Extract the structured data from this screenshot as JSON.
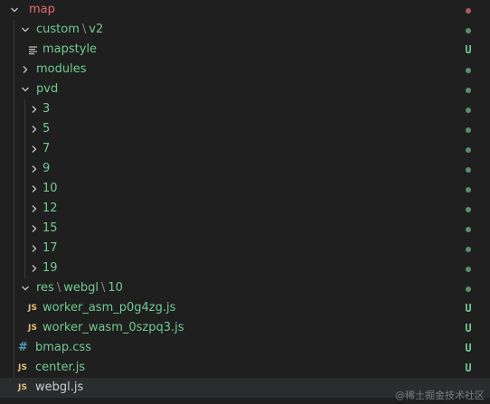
{
  "tree": {
    "rows": [
      {
        "label": "map",
        "path": [],
        "type": "folder",
        "open": true,
        "level": 0,
        "color": "red",
        "status": "dot-red"
      },
      {
        "label": "custom",
        "path": [
          "v2"
        ],
        "type": "folder",
        "open": true,
        "level": 1,
        "color": "green",
        "status": "dot"
      },
      {
        "label": "mapstyle",
        "path": [],
        "type": "file",
        "icon": "lines",
        "level": 2,
        "color": "green",
        "status": "U"
      },
      {
        "label": "modules",
        "path": [],
        "type": "folder",
        "open": false,
        "level": 1,
        "color": "green",
        "status": "dot"
      },
      {
        "label": "pvd",
        "path": [],
        "type": "folder",
        "open": true,
        "level": 1,
        "color": "green",
        "status": "dot"
      },
      {
        "label": "3",
        "path": [],
        "type": "folder",
        "open": false,
        "level": 2,
        "color": "green",
        "status": "dot"
      },
      {
        "label": "5",
        "path": [],
        "type": "folder",
        "open": false,
        "level": 2,
        "color": "green",
        "status": "dot"
      },
      {
        "label": "7",
        "path": [],
        "type": "folder",
        "open": false,
        "level": 2,
        "color": "green",
        "status": "dot"
      },
      {
        "label": "9",
        "path": [],
        "type": "folder",
        "open": false,
        "level": 2,
        "color": "green",
        "status": "dot"
      },
      {
        "label": "10",
        "path": [],
        "type": "folder",
        "open": false,
        "level": 2,
        "color": "green",
        "status": "dot"
      },
      {
        "label": "12",
        "path": [],
        "type": "folder",
        "open": false,
        "level": 2,
        "color": "green",
        "status": "dot"
      },
      {
        "label": "15",
        "path": [],
        "type": "folder",
        "open": false,
        "level": 2,
        "color": "green",
        "status": "dot"
      },
      {
        "label": "17",
        "path": [],
        "type": "folder",
        "open": false,
        "level": 2,
        "color": "green",
        "status": "dot"
      },
      {
        "label": "19",
        "path": [],
        "type": "folder",
        "open": false,
        "level": 2,
        "color": "green",
        "status": "dot"
      },
      {
        "label": "res",
        "path": [
          "webgl",
          "10"
        ],
        "type": "folder",
        "open": true,
        "level": 1,
        "color": "green",
        "status": "dot"
      },
      {
        "label": "worker_asm_p0g4zg.js",
        "path": [],
        "type": "file",
        "icon": "js",
        "level": 2,
        "color": "green",
        "status": "U"
      },
      {
        "label": "worker_wasm_0szpq3.js",
        "path": [],
        "type": "file",
        "icon": "js",
        "level": 2,
        "color": "green",
        "status": "U"
      },
      {
        "label": "bmap.css",
        "path": [],
        "type": "file",
        "icon": "hash",
        "level": 1,
        "color": "green",
        "status": "U"
      },
      {
        "label": "center.js",
        "path": [],
        "type": "file",
        "icon": "js",
        "level": 1,
        "color": "green",
        "status": "U"
      },
      {
        "label": "webgl.js",
        "path": [],
        "type": "file",
        "icon": "js",
        "level": 1,
        "color": "white",
        "status": "",
        "selected": true
      }
    ],
    "icons": {
      "js": "JS",
      "hash": "#"
    }
  },
  "watermark": "@稀土掘金技术社区",
  "colors": {
    "background": "#1f1f1f",
    "untracked_green": "#73c991",
    "modified_red": "#e06c75",
    "js_yellow": "#e5c07b",
    "css_blue": "#519aba",
    "selection": "#2a2d2e"
  }
}
